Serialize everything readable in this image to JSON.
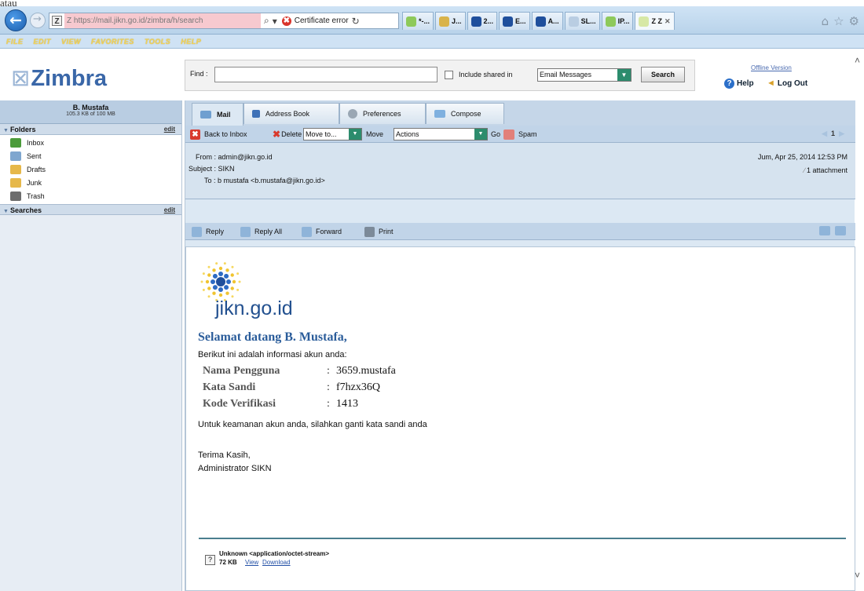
{
  "top_cut_text": "atau",
  "browser": {
    "url_host": "Z https://mail.jikn.go.id/zimbra/h/search",
    "cert_error": "Certificate error",
    "tabs": [
      {
        "label": "*-...",
        "color": "#8ec95a"
      },
      {
        "label": "J...",
        "color": "#d9b34a"
      },
      {
        "label": "2...",
        "color": "#1f4f9c"
      },
      {
        "label": "E...",
        "color": "#1f4f9c"
      },
      {
        "label": "A...",
        "color": "#1f4f9c"
      },
      {
        "label": "SL...",
        "color": "#b9cde2"
      },
      {
        "label": "IP...",
        "color": "#8ec95a"
      },
      {
        "label": "Z Z",
        "color": "#d7e8a5",
        "active": true
      }
    ],
    "menu": [
      "FILE",
      "EDIT",
      "VIEW",
      "FAVORITES",
      "TOOLS",
      "HELP"
    ]
  },
  "zimbra": {
    "logo": "Zimbra",
    "find_label": "Find :",
    "find_value": "",
    "include_shared_label": "Include shared in",
    "search_scope": "Email Messages",
    "search_button": "Search",
    "offline_version": "Offline Version",
    "help": "Help",
    "logout": "Log Out"
  },
  "sidebar": {
    "user_name": "B. Mustafa",
    "user_quota": "105.3 KB of 100 MB",
    "folders_title": "Folders",
    "edit_label": "edit",
    "folders": [
      {
        "label": "Inbox",
        "color": "#4b9b3a"
      },
      {
        "label": "Sent",
        "color": "#7fa6cf"
      },
      {
        "label": "Drafts",
        "color": "#e6b84a"
      },
      {
        "label": "Junk",
        "color": "#e6b84a"
      },
      {
        "label": "Trash",
        "color": "#6d6d6d"
      }
    ],
    "searches_title": "Searches"
  },
  "main": {
    "tabs": [
      "Mail",
      "Address Book",
      "Preferences",
      "Compose"
    ],
    "toolbar": {
      "back": "Back to Inbox",
      "delete": "Delete",
      "move_select": "Move to...",
      "move": "Move",
      "actions_select": "Actions",
      "go": "Go",
      "spam": "Spam",
      "page": "1"
    },
    "message": {
      "from": "From : admin@jikn.go.id",
      "subject": "Subject : SIKN",
      "to": "To : b mustafa <b.mustafa@jikn.go.id>",
      "date": "Jum, Apr 25, 2014 12:53 PM",
      "attachment_count": "1 attachment"
    },
    "actions": [
      "Reply",
      "Reply All",
      "Forward",
      "Print"
    ]
  },
  "body": {
    "site_name": "jikn.go.id",
    "greeting": "Selamat datang B. Mustafa,",
    "intro": "Berikut ini adalah informasi akun anda:",
    "credentials": [
      {
        "key": "Nama Pengguna",
        "value": "3659.mustafa"
      },
      {
        "key": "Kata Sandi",
        "value": "f7hzx36Q"
      },
      {
        "key": "Kode Verifikasi",
        "value": "1413"
      }
    ],
    "warning": "Untuk keamanan akun anda, silahkan ganti kata sandi anda",
    "thanks": "Terima Kasih,",
    "signer": "Administrator SIKN",
    "attachment": {
      "name": "Unknown <application/octet-stream>",
      "size": "72 KB",
      "view": "View",
      "download": "Download"
    }
  }
}
